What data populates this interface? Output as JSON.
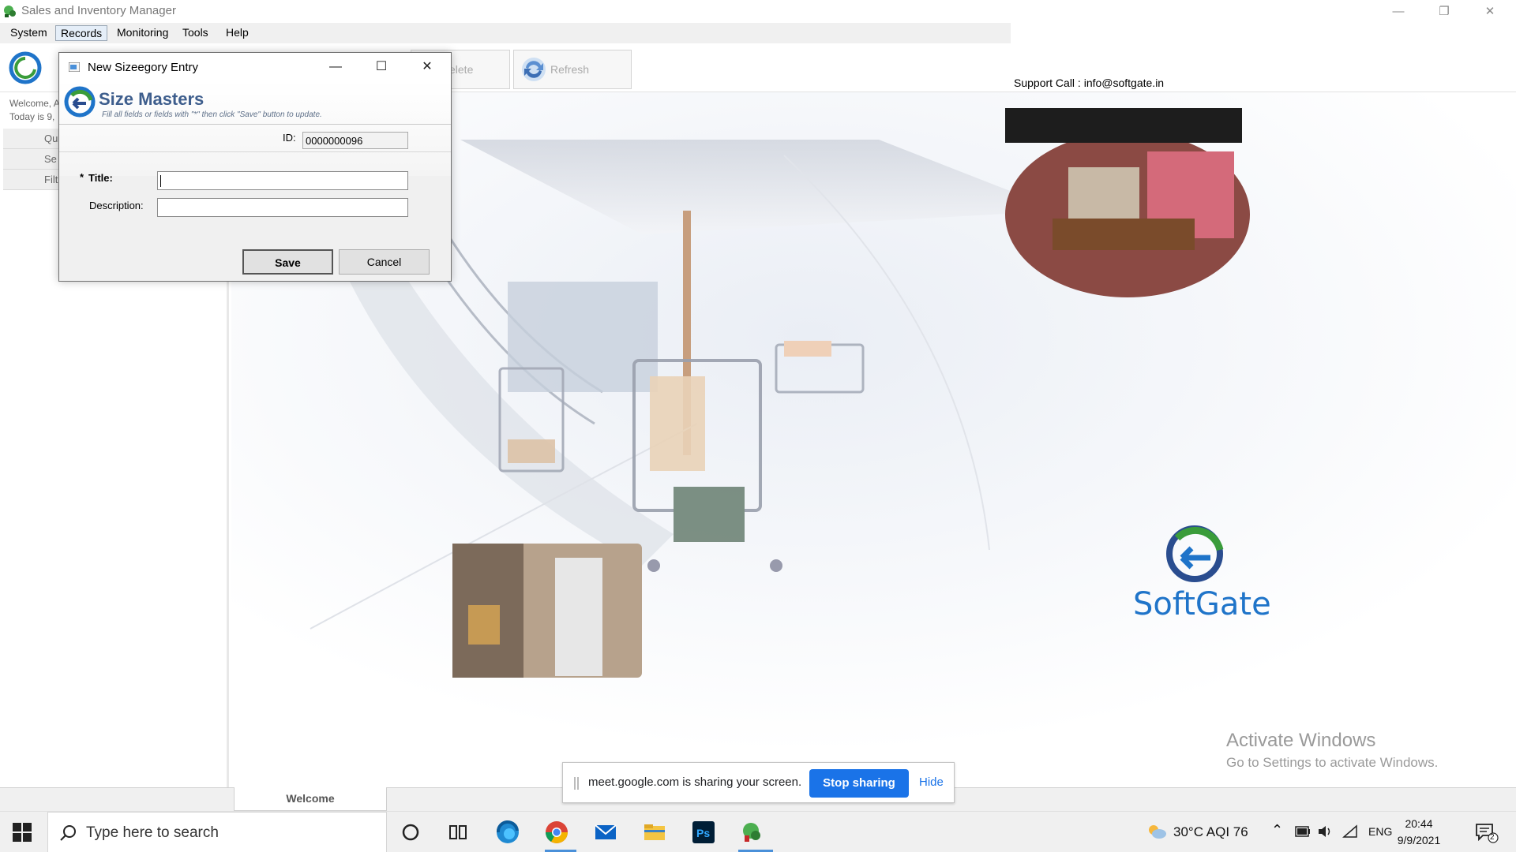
{
  "window": {
    "title": "Sales and Inventory Manager",
    "minimize": "—",
    "restore": "❐",
    "close": "✕"
  },
  "menu": [
    "System",
    "Records",
    "Monitoring",
    "Tools",
    "Help"
  ],
  "menu_active": "Records",
  "toolbar": {
    "delete_label": "elete",
    "refresh_label": "Refresh",
    "support": "Support Call : info@softgate.in"
  },
  "left_panel": {
    "welcome": "Welcome, A",
    "today": "Today is  9,",
    "rows": [
      "Qu",
      "Se",
      "Filt"
    ]
  },
  "brand": {
    "logo_text": "SoftGate",
    "colors": {
      "blue": "#1f74c9",
      "green": "#3a9c3a",
      "navy": "#2a4d8f"
    }
  },
  "bottom_tab": "Welcome",
  "activate": {
    "line1": "Activate Windows",
    "line2": "Go to Settings to activate Windows."
  },
  "dialog": {
    "title": "New Sizeegory Entry",
    "minimize": "—",
    "maximize": "☐",
    "close": "✕",
    "header_title": "Size Masters",
    "header_sub": "Fill all fields or fields with \"*\" then click \"Save\" button to update.",
    "id_label": "ID:",
    "id_value": "0000000096",
    "title_label_star": "*",
    "title_label": "Title:",
    "title_value": "",
    "desc_label": "Description:",
    "desc_value": "",
    "save": "Save",
    "cancel": "Cancel"
  },
  "sharebar": {
    "message": "meet.google.com is sharing your screen.",
    "stop": "Stop sharing",
    "hide": "Hide"
  },
  "taskbar": {
    "search_placeholder": "Type here to search",
    "weather": "30°C  AQI 76",
    "lang": "ENG",
    "time": "20:44",
    "date": "9/9/2021",
    "notifications": "2",
    "apps": [
      "cortana-icon",
      "task-view-icon",
      "edge-icon",
      "chrome-icon",
      "mail-icon",
      "file-explorer-icon",
      "photoshop-icon",
      "sales-inventory-app-icon"
    ]
  }
}
